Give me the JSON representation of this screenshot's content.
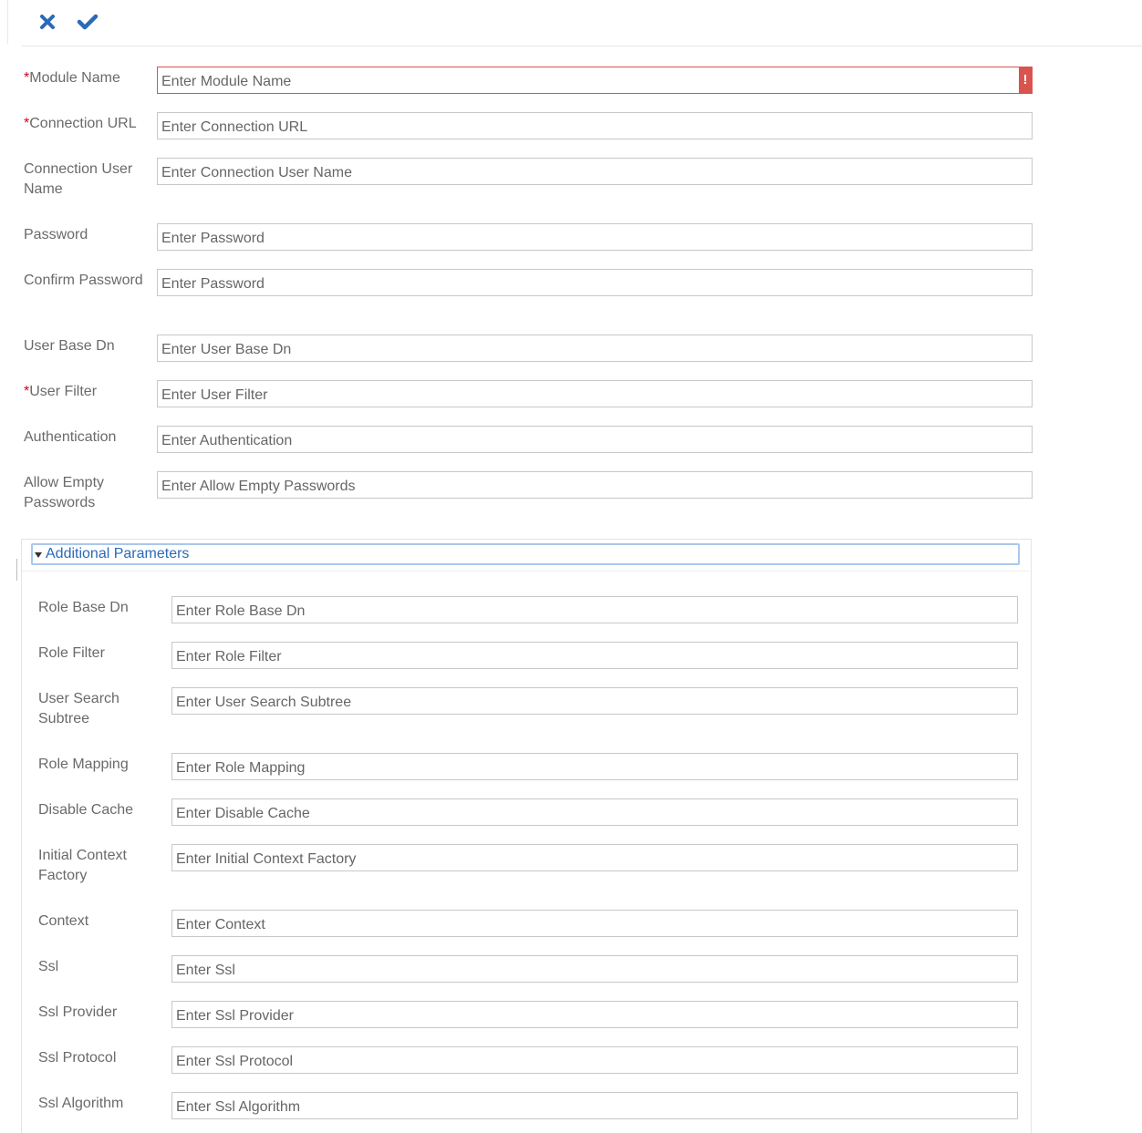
{
  "toolbar": {
    "cancel_icon": "close-icon",
    "save_icon": "check-icon",
    "accent": "#2a6ab8"
  },
  "form": {
    "fields": [
      {
        "label": "Module Name",
        "required": true,
        "placeholder": "Enter Module Name",
        "invalid": true,
        "error_mark": "!"
      },
      {
        "label": "Connection URL",
        "required": true,
        "placeholder": "Enter Connection URL"
      },
      {
        "label": "Connection User Name",
        "required": false,
        "placeholder": "Enter Connection User Name"
      },
      {
        "label": "Password",
        "required": false,
        "placeholder": "Enter Password"
      },
      {
        "label": "Confirm Password",
        "required": false,
        "placeholder": "Enter Password"
      },
      {
        "label": "User Base Dn",
        "required": false,
        "placeholder": "Enter User Base Dn"
      },
      {
        "label": "User Filter",
        "required": true,
        "placeholder": "Enter User Filter"
      },
      {
        "label": "Authentication",
        "required": false,
        "placeholder": "Enter Authentication"
      },
      {
        "label": "Allow Empty Passwords",
        "required": false,
        "placeholder": "Enter Allow Empty Passwords"
      }
    ],
    "required_marker": "*"
  },
  "additional": {
    "title": "Additional Parameters",
    "expanded": true,
    "fields": [
      {
        "label": "Role Base Dn",
        "placeholder": "Enter Role Base Dn"
      },
      {
        "label": "Role Filter",
        "placeholder": "Enter Role Filter"
      },
      {
        "label": "User Search Subtree",
        "placeholder": "Enter User Search Subtree"
      },
      {
        "label": "Role Mapping",
        "placeholder": "Enter Role Mapping"
      },
      {
        "label": "Disable Cache",
        "placeholder": "Enter Disable Cache"
      },
      {
        "label": "Initial Context Factory",
        "placeholder": "Enter Initial Context Factory"
      },
      {
        "label": "Context",
        "placeholder": "Enter Context"
      },
      {
        "label": "Ssl",
        "placeholder": "Enter Ssl"
      },
      {
        "label": "Ssl Provider",
        "placeholder": "Enter Ssl Provider"
      },
      {
        "label": "Ssl Protocol",
        "placeholder": "Enter Ssl Protocol"
      },
      {
        "label": "Ssl Algorithm",
        "placeholder": "Enter Ssl Algorithm"
      }
    ]
  },
  "colors": {
    "error": "#d9534f",
    "required": "#d0021b",
    "link": "#2a6ab8"
  }
}
